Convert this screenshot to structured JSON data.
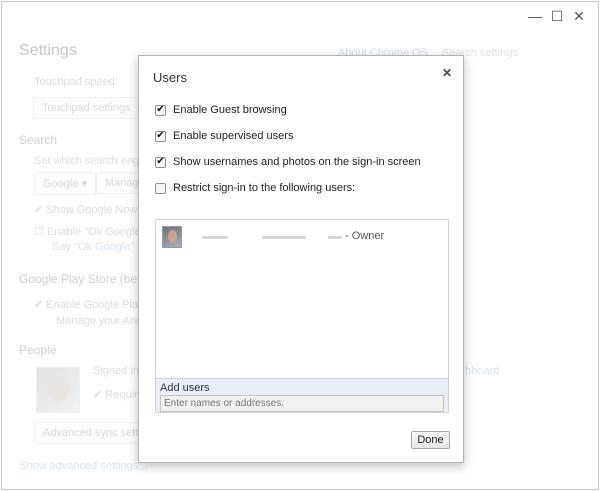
{
  "window": {
    "controls": [
      "—",
      "☐",
      "✕"
    ]
  },
  "settings": {
    "title": "Settings",
    "about_link": "About Chrome OS",
    "search_placeholder": "Search settings",
    "touchpad_speed_label": "Touchpad speed:",
    "touchpad_settings_button": "Touchpad settings",
    "search_section": "Search",
    "search_desc": "Set which search engine i",
    "search_engine_select": "Google",
    "manage_button": "Manage",
    "show_google_now": "Show Google Now ca",
    "enable_ok_google": "Enable \"Ok Google\" to",
    "say_ok_google": "Say \"Ok Google\" in a",
    "play_store_section": "Google Play Store (beta)",
    "enable_play_store": "Enable Google Play S",
    "manage_android": "Manage your Androi",
    "people_section": "People",
    "signed_in": "Signed in a",
    "require": "Require",
    "dashboard_link": "hboard",
    "advanced_sync_button": "Advanced sync settings",
    "show_advanced_link": "Show advanced settings..."
  },
  "dialog": {
    "title": "Users",
    "close_icon": "close-icon",
    "options": [
      {
        "label": "Enable Guest browsing",
        "checked": true
      },
      {
        "label": "Enable supervised users",
        "checked": true
      },
      {
        "label": "Show usernames and photos on the sign-in screen",
        "checked": true
      },
      {
        "label": "Restrict sign-in to the following users:",
        "checked": false
      }
    ],
    "user_owner_label": "- Owner",
    "add_users_label": "Add users",
    "add_users_placeholder": "Enter names or addresses.",
    "done_button": "Done"
  }
}
